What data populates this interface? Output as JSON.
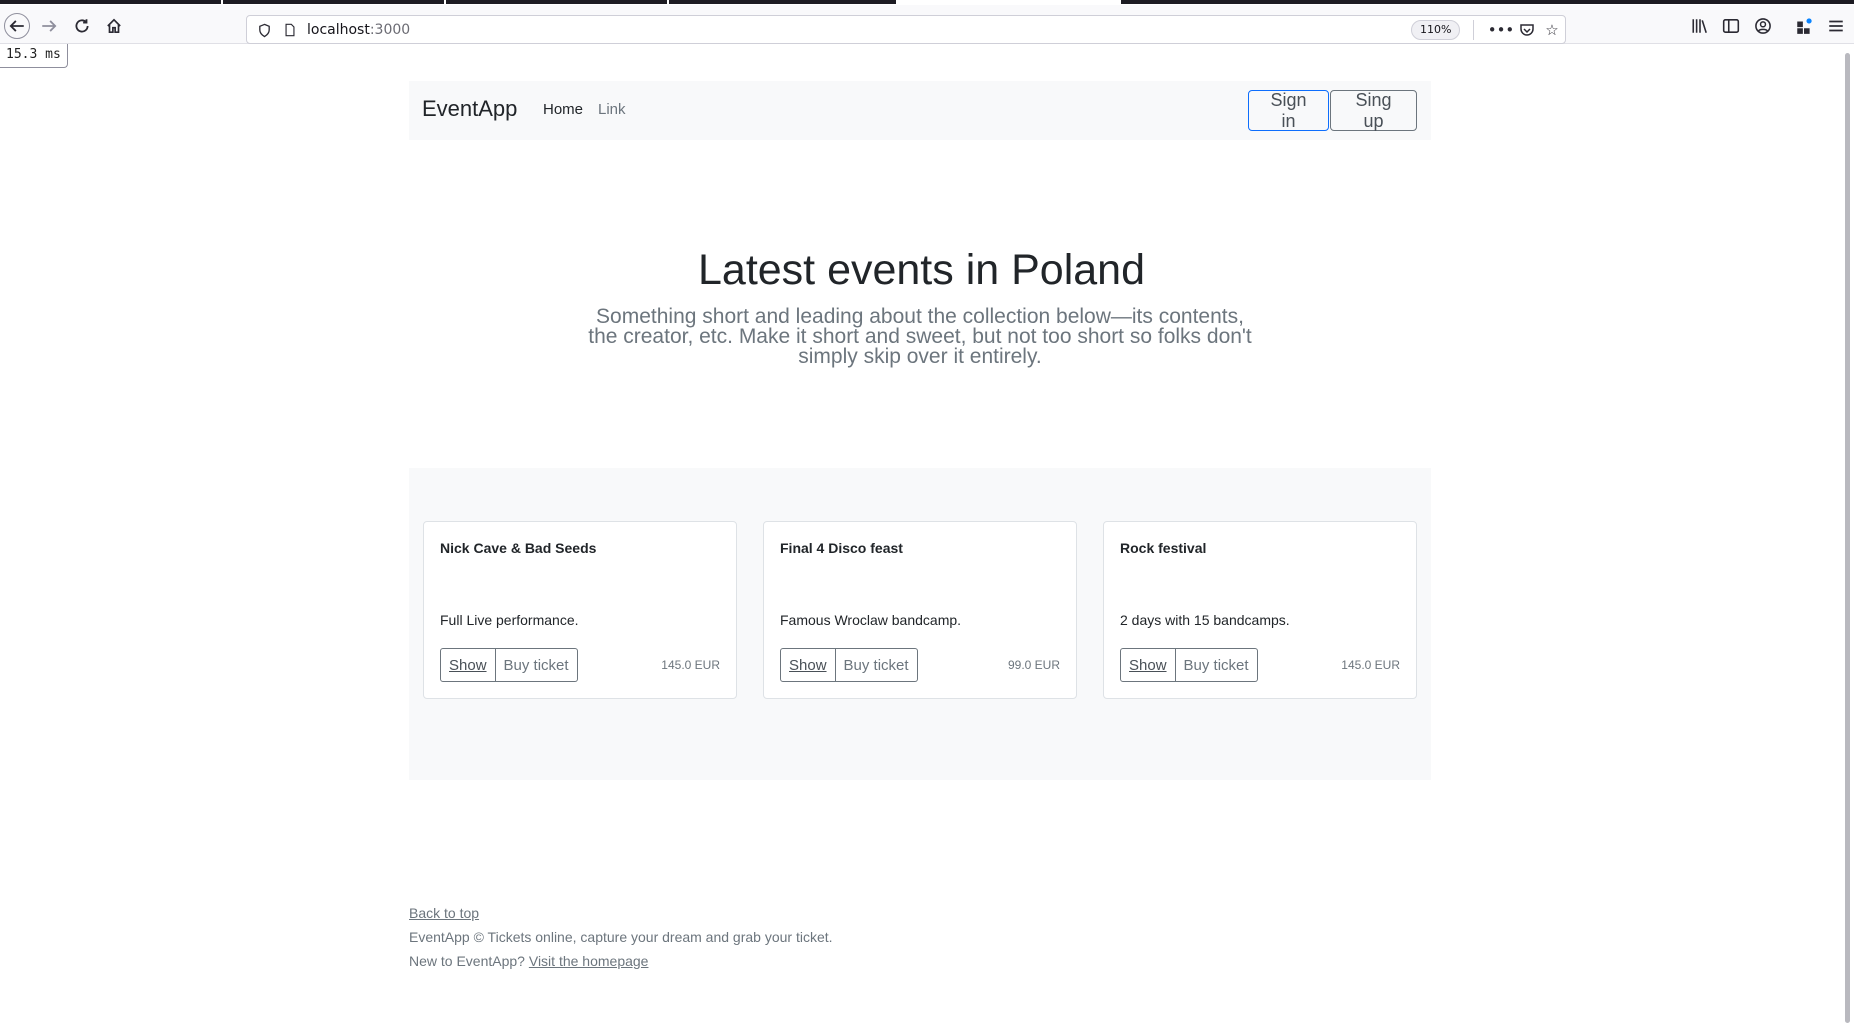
{
  "browser": {
    "url_host": "localhost",
    "url_port": ":3000",
    "zoom": "110%",
    "timing": "15.3 ms",
    "icons": [
      "back-arrow-icon",
      "forward-arrow-icon",
      "reload-icon",
      "home-icon",
      "shield-icon",
      "page-icon",
      "more-icon",
      "pocket-icon",
      "star-icon",
      "library-icon",
      "sidebar-icon",
      "account-icon",
      "extensions-icon",
      "menu-icon"
    ]
  },
  "nav": {
    "brand": "EventApp",
    "links": [
      "Home",
      "Link"
    ],
    "sign_in": "Sign in",
    "sign_up": "Sing up"
  },
  "hero": {
    "title": "Latest events in Poland",
    "lead": "Something short and leading about the collection below—its contents, the creator, etc. Make it short and sweet, but not too short so folks don't simply skip over it entirely."
  },
  "events": [
    {
      "title": "Nick Cave & Bad Seeds",
      "description": "Full Live performance.",
      "show_label": "Show",
      "buy_label": "Buy ticket",
      "price": "145.0 EUR"
    },
    {
      "title": "Final 4 Disco feast",
      "description": "Famous Wroclaw bandcamp.",
      "show_label": "Show",
      "buy_label": "Buy ticket",
      "price": "99.0 EUR"
    },
    {
      "title": "Rock festival",
      "description": "2 days with 15 bandcamps.",
      "show_label": "Show",
      "buy_label": "Buy ticket",
      "price": "145.0 EUR"
    }
  ],
  "footer": {
    "back_to_top": "Back to top",
    "tagline": "EventApp © Tickets online, capture your dream and grab your ticket.",
    "new_prefix": "New to EventApp?",
    "homepage_link": "Visit the homepage"
  },
  "colors": {
    "accent": "#0d6efd",
    "muted": "#6c757d",
    "panel": "#f8f9fa"
  }
}
